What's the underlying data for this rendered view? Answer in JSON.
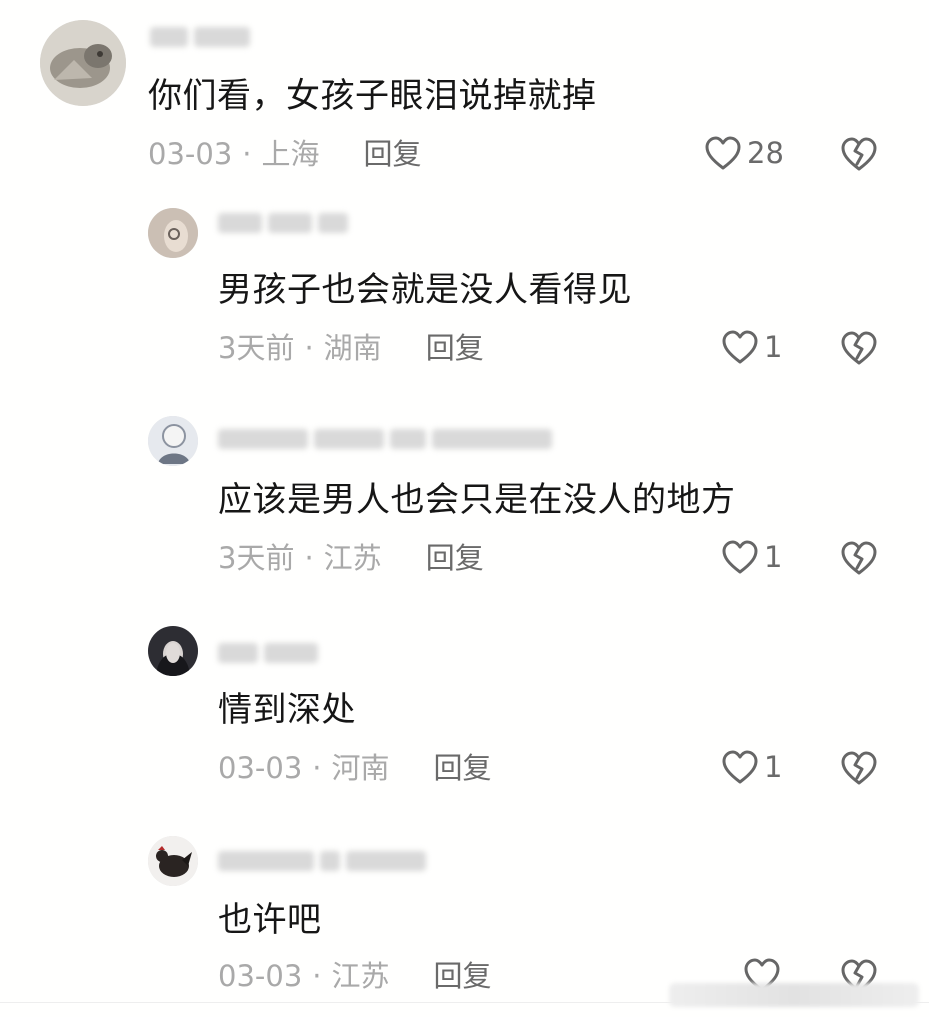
{
  "comments": [
    {
      "text": "你们看，女孩子眼泪说掉就掉",
      "date": "03-03",
      "separator": "·",
      "location": "上海",
      "reply_label": "回复",
      "likes": "28"
    },
    {
      "text": "男孩子也会就是没人看得见",
      "date": "3天前",
      "separator": "·",
      "location": "湖南",
      "reply_label": "回复",
      "likes": "1"
    },
    {
      "text": "应该是男人也会只是在没人的地方",
      "date": "3天前",
      "separator": "·",
      "location": "江苏",
      "reply_label": "回复",
      "likes": "1"
    },
    {
      "text": "情到深处",
      "date": "03-03",
      "separator": "·",
      "location": "河南",
      "reply_label": "回复",
      "likes": "1"
    },
    {
      "text": "也许吧",
      "date": "03-03",
      "separator": "·",
      "location": "江苏",
      "reply_label": "回复",
      "likes": ""
    }
  ],
  "icons": {
    "like": "heart-outline-icon",
    "dislike": "broken-heart-icon"
  },
  "colors": {
    "text": "#161616",
    "meta": "#a9a9a9",
    "action": "#6a6a6a"
  }
}
